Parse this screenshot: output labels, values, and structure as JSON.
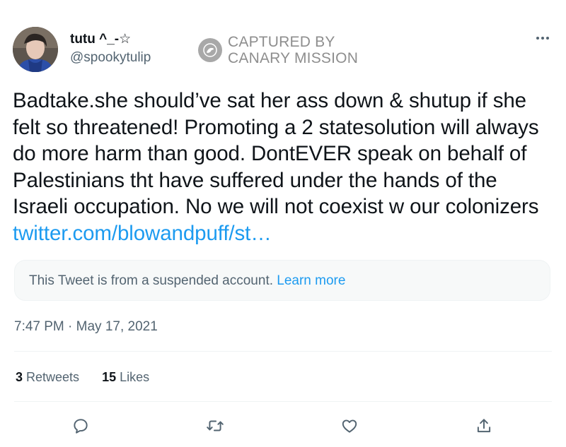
{
  "author": {
    "display_name": "tutu ^_-☆",
    "handle": "@spookytulip"
  },
  "watermark": {
    "line1": "CAPTURED BY",
    "line2": "CANARY MISSION",
    "logo_icon": "canary-bird-icon"
  },
  "tweet": {
    "text": "Badtake.she should’ve sat her ass down & shutup if she felt so threatened! Promoting a 2 statesolution will always do more harm than good. DontEVER speak on behalf of Palestinians tht have suffered under the hands of the Israeli occupation. No we will not coexist w our colonizers ",
    "link": "twitter.com/blowandpuff/st…"
  },
  "quote_notice": {
    "text": "This Tweet is from a suspended account. ",
    "link_text": "Learn more"
  },
  "timestamp": "7:47 PM · May 17, 2021",
  "stats": {
    "retweets_count": "3",
    "retweets_label": " Retweets",
    "likes_count": "15",
    "likes_label": " Likes"
  },
  "actions": [
    "reply-icon",
    "retweet-icon",
    "like-icon",
    "share-icon"
  ],
  "colors": {
    "link": "#1d9bf0",
    "secondary_text": "#536471",
    "primary_text": "#0f1419",
    "watermark": "#8e8e8e"
  }
}
